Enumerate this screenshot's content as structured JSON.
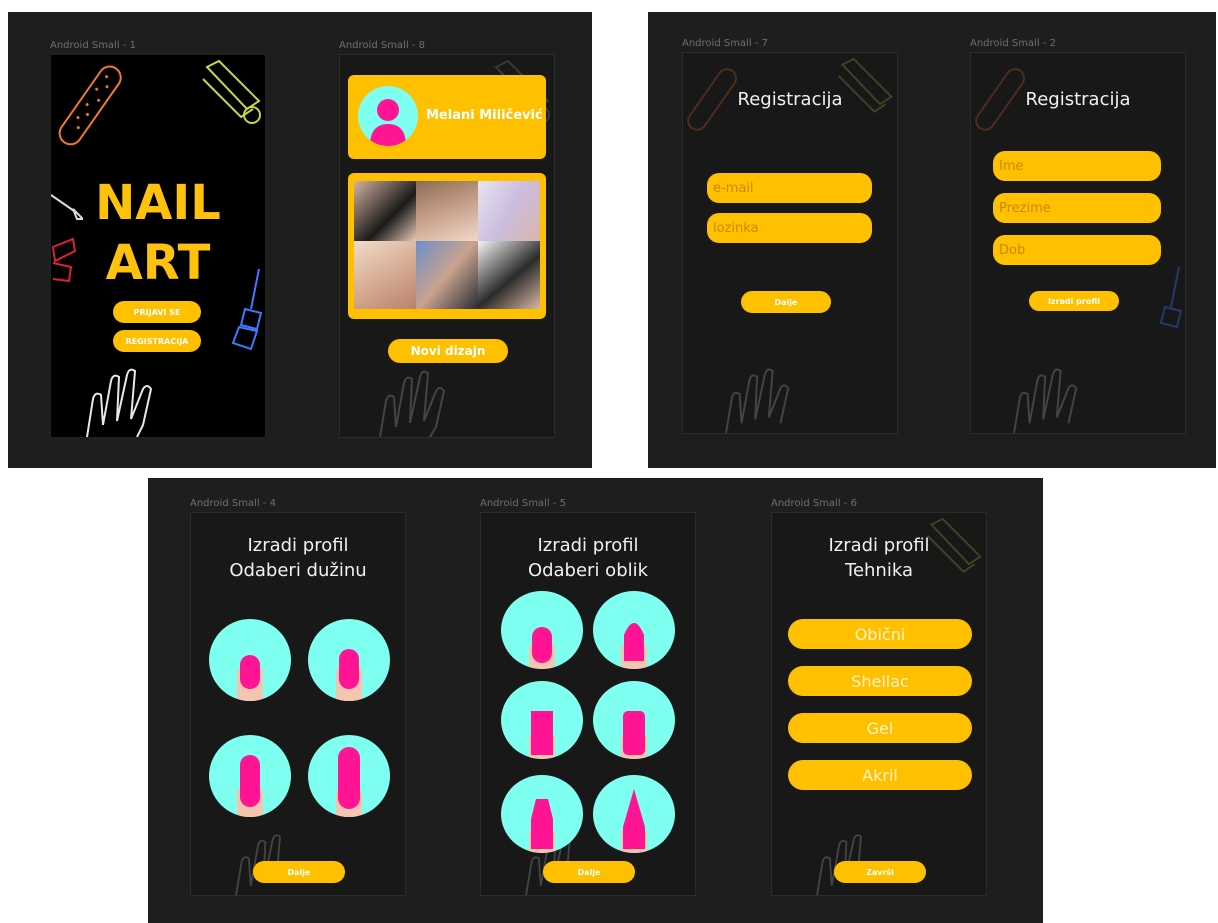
{
  "colors": {
    "accent": "#ffc000",
    "nail": "#ff1493",
    "circle": "#7ffff0",
    "skin": "#f4c6b0",
    "canvas": "#1e1e1e"
  },
  "frames": {
    "s1": {
      "label": "Android Small - 1",
      "title_line1": "NAIL",
      "title_line2": "ART",
      "btn_login": "PRIJAVI SE",
      "btn_register": "REGISTRACIJA"
    },
    "s8": {
      "label": "Android Small - 8",
      "user_name": "Melani Miličević",
      "btn_new": "Novi dizajn",
      "avatar_icon": "user-avatar-icon"
    },
    "s7": {
      "label": "Android Small - 7",
      "title": "Registracija",
      "email_placeholder": "e-mail",
      "password_placeholder": "lozinka",
      "btn_next": "Dalje"
    },
    "s2": {
      "label": "Android Small - 2",
      "title": "Registracija",
      "field_name": "Ime",
      "field_surname": "Prezime",
      "field_age": "Dob",
      "btn_create": "Izradi profil"
    },
    "s4": {
      "label": "Android Small - 4",
      "title_line1": "Izradi profil",
      "title_line2": "Odaberi dužinu",
      "btn_next": "Dalje"
    },
    "s5": {
      "label": "Android Small - 5",
      "title_line1": "Izradi profil",
      "title_line2": "Odaberi oblik",
      "btn_next": "Dalje"
    },
    "s6": {
      "label": "Android Small - 6",
      "title_line1": "Izradi profil",
      "title_line2": "Tehnika",
      "options": [
        "Obični",
        "Shellac",
        "Gel",
        "Akril"
      ],
      "btn_finish": "Završi"
    }
  }
}
